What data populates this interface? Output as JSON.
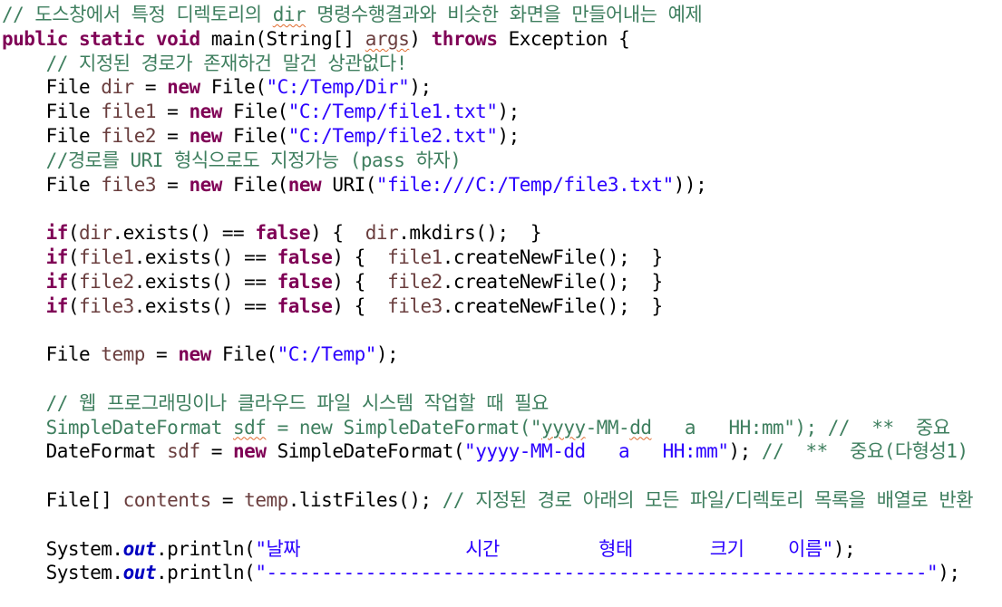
{
  "lines": [
    [
      {
        "t": "// 도스창에서 특정 디렉토리의 ",
        "c": "cm"
      },
      {
        "t": "dir",
        "c": "cm sq"
      },
      {
        "t": " 명령수행결과와 비슷한 화면을 만들어내는 예제",
        "c": "cm"
      }
    ],
    [
      {
        "t": "public",
        "c": "kw"
      },
      {
        "t": " "
      },
      {
        "t": "static",
        "c": "kw"
      },
      {
        "t": " "
      },
      {
        "t": "void",
        "c": "kw"
      },
      {
        "t": " main(String[] "
      },
      {
        "t": "args",
        "c": "var sq"
      },
      {
        "t": ") "
      },
      {
        "t": "throws",
        "c": "kw"
      },
      {
        "t": " Exception {"
      }
    ],
    [
      {
        "t": "    "
      },
      {
        "t": "// 지정된 경로가 존재하건 말건 상관없다!",
        "c": "cm"
      }
    ],
    [
      {
        "t": "    File "
      },
      {
        "t": "dir",
        "c": "var"
      },
      {
        "t": " = "
      },
      {
        "t": "new",
        "c": "kw"
      },
      {
        "t": " File("
      },
      {
        "t": "\"C:/Temp/Dir\"",
        "c": "str"
      },
      {
        "t": ");"
      }
    ],
    [
      {
        "t": "    File "
      },
      {
        "t": "file1",
        "c": "var"
      },
      {
        "t": " = "
      },
      {
        "t": "new",
        "c": "kw"
      },
      {
        "t": " File("
      },
      {
        "t": "\"C:/Temp/file1.txt\"",
        "c": "str"
      },
      {
        "t": ");"
      }
    ],
    [
      {
        "t": "    File "
      },
      {
        "t": "file2",
        "c": "var"
      },
      {
        "t": " = "
      },
      {
        "t": "new",
        "c": "kw"
      },
      {
        "t": " File("
      },
      {
        "t": "\"C:/Temp/file2.txt\"",
        "c": "str"
      },
      {
        "t": ");"
      }
    ],
    [
      {
        "t": "    "
      },
      {
        "t": "//경로를 URI 형식으로도 지정가능 (pass 하자)",
        "c": "cm"
      }
    ],
    [
      {
        "t": "    File "
      },
      {
        "t": "file3",
        "c": "var"
      },
      {
        "t": " = "
      },
      {
        "t": "new",
        "c": "kw"
      },
      {
        "t": " File("
      },
      {
        "t": "new",
        "c": "kw"
      },
      {
        "t": " URI("
      },
      {
        "t": "\"file:///C:/Temp/file3.txt\"",
        "c": "str"
      },
      {
        "t": "));"
      }
    ],
    [],
    [
      {
        "t": "    "
      },
      {
        "t": "if",
        "c": "kw"
      },
      {
        "t": "("
      },
      {
        "t": "dir",
        "c": "var"
      },
      {
        "t": ".exists() == "
      },
      {
        "t": "false",
        "c": "kw"
      },
      {
        "t": ") {  "
      },
      {
        "t": "dir",
        "c": "var"
      },
      {
        "t": ".mkdirs();  }"
      }
    ],
    [
      {
        "t": "    "
      },
      {
        "t": "if",
        "c": "kw"
      },
      {
        "t": "("
      },
      {
        "t": "file1",
        "c": "var"
      },
      {
        "t": ".exists() == "
      },
      {
        "t": "false",
        "c": "kw"
      },
      {
        "t": ") {  "
      },
      {
        "t": "file1",
        "c": "var"
      },
      {
        "t": ".createNewFile();  }"
      }
    ],
    [
      {
        "t": "    "
      },
      {
        "t": "if",
        "c": "kw"
      },
      {
        "t": "("
      },
      {
        "t": "file2",
        "c": "var"
      },
      {
        "t": ".exists() == "
      },
      {
        "t": "false",
        "c": "kw"
      },
      {
        "t": ") {  "
      },
      {
        "t": "file2",
        "c": "var"
      },
      {
        "t": ".createNewFile();  }"
      }
    ],
    [
      {
        "t": "    "
      },
      {
        "t": "if",
        "c": "kw"
      },
      {
        "t": "("
      },
      {
        "t": "file3",
        "c": "var"
      },
      {
        "t": ".exists() == "
      },
      {
        "t": "false",
        "c": "kw"
      },
      {
        "t": ") {  "
      },
      {
        "t": "file3",
        "c": "var"
      },
      {
        "t": ".createNewFile();  }"
      }
    ],
    [],
    [
      {
        "t": "    File "
      },
      {
        "t": "temp",
        "c": "var"
      },
      {
        "t": " = "
      },
      {
        "t": "new",
        "c": "kw"
      },
      {
        "t": " File("
      },
      {
        "t": "\"C:/Temp\"",
        "c": "str"
      },
      {
        "t": ");"
      }
    ],
    [],
    [
      {
        "t": "    "
      },
      {
        "t": "// 웹 프로그래밍이나 클라우드 파일 시스템 작업할 때 필요",
        "c": "cm"
      }
    ],
    [
      {
        "t": "    "
      },
      {
        "t": "SimpleDateFormat ",
        "c": "cm"
      },
      {
        "t": "sdf",
        "c": "cm sq"
      },
      {
        "t": " = new SimpleDateFormat(\"",
        "c": "cm"
      },
      {
        "t": "yyyy",
        "c": "cm sq"
      },
      {
        "t": "-MM-",
        "c": "cm"
      },
      {
        "t": "dd",
        "c": "cm sq"
      },
      {
        "t": "   a   HH:mm\"); //  **  중요",
        "c": "cm"
      }
    ],
    [
      {
        "t": "    DateFormat "
      },
      {
        "t": "sdf",
        "c": "var"
      },
      {
        "t": " = "
      },
      {
        "t": "new",
        "c": "kw"
      },
      {
        "t": " SimpleDateFormat("
      },
      {
        "t": "\"yyyy-MM-dd   a   HH:mm\"",
        "c": "str"
      },
      {
        "t": "); "
      },
      {
        "t": "//  **  중요(다형성1)",
        "c": "cm"
      }
    ],
    [],
    [
      {
        "t": "    File[] "
      },
      {
        "t": "contents",
        "c": "var"
      },
      {
        "t": " = "
      },
      {
        "t": "temp",
        "c": "var"
      },
      {
        "t": ".listFiles(); "
      },
      {
        "t": "// 지정된 경로 아래의 모든 파일/디렉토리 목록을 배열로 반환",
        "c": "cm"
      }
    ],
    [],
    [
      {
        "t": "    System."
      },
      {
        "t": "out",
        "c": "fld"
      },
      {
        "t": ".println("
      },
      {
        "t": "\"날짜               시간         형태       크기    이름\"",
        "c": "str"
      },
      {
        "t": ");"
      }
    ],
    [
      {
        "t": "    System."
      },
      {
        "t": "out",
        "c": "fld"
      },
      {
        "t": ".println("
      },
      {
        "t": "\"------------------------------------------------------------\"",
        "c": "str"
      },
      {
        "t": ");"
      }
    ]
  ]
}
